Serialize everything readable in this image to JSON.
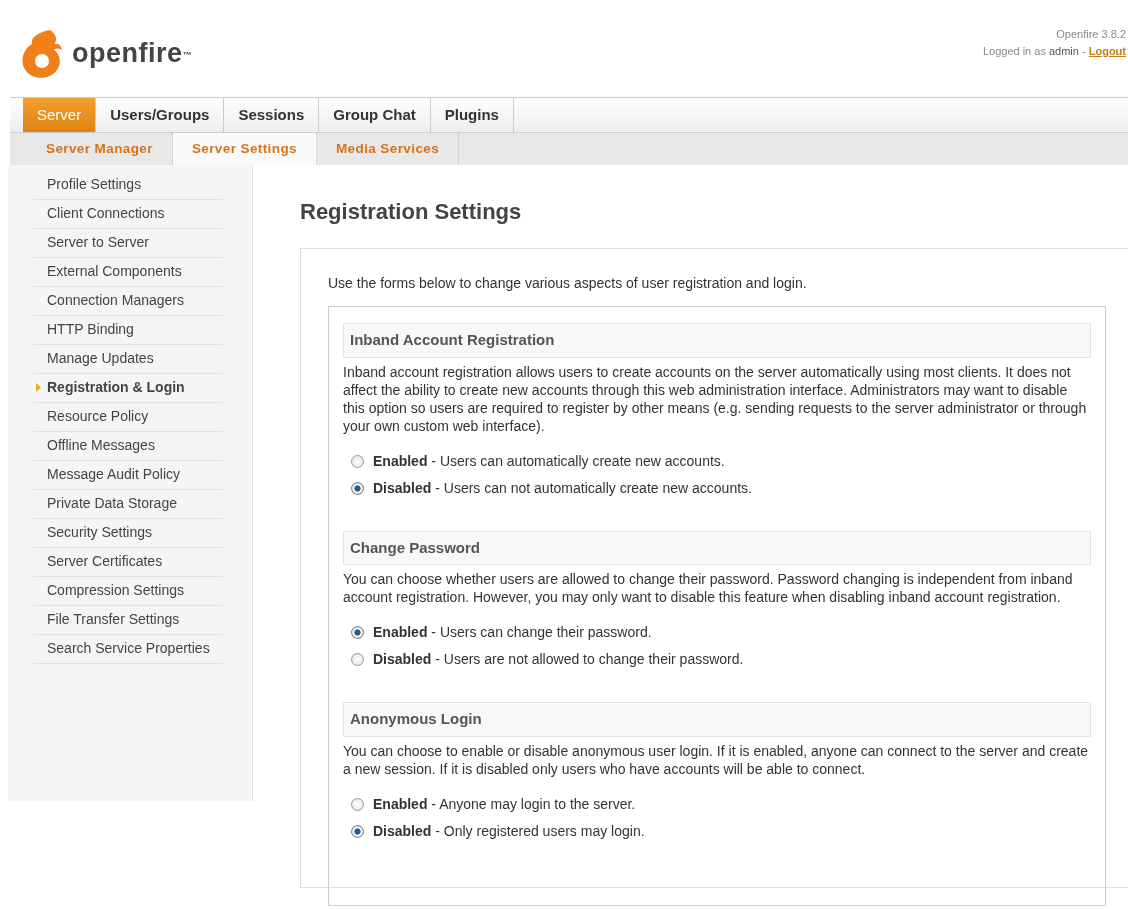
{
  "header": {
    "logo_text": "openfire$^{™}$",
    "version": "Openfire 3.8.2",
    "logged_in_prefix": "Logged in as",
    "user": "admin",
    "separator": "-",
    "logout": "Logout"
  },
  "tabs": [
    {
      "label": "Server",
      "selected": true
    },
    {
      "label": "Users/Groups",
      "selected": false
    },
    {
      "label": "Sessions",
      "selected": false
    },
    {
      "label": "Group Chat",
      "selected": false
    },
    {
      "label": "Plugins",
      "selected": false
    }
  ],
  "subtabs": [
    {
      "label": "Server Manager",
      "selected": false
    },
    {
      "label": "Server Settings",
      "selected": true
    },
    {
      "label": "Media Services",
      "selected": false
    }
  ],
  "sidebar": {
    "items": [
      {
        "label": "Profile Settings",
        "selected": false
      },
      {
        "label": "Client Connections",
        "selected": false
      },
      {
        "label": "Server to Server",
        "selected": false
      },
      {
        "label": "External Components",
        "selected": false
      },
      {
        "label": "Connection Managers",
        "selected": false
      },
      {
        "label": "HTTP Binding",
        "selected": false
      },
      {
        "label": "Manage Updates",
        "selected": false
      },
      {
        "label": "Registration & Login",
        "selected": true
      },
      {
        "label": "Resource Policy",
        "selected": false
      },
      {
        "label": "Offline Messages",
        "selected": false
      },
      {
        "label": "Message Audit Policy",
        "selected": false
      },
      {
        "label": "Private Data Storage",
        "selected": false
      },
      {
        "label": "Security Settings",
        "selected": false
      },
      {
        "label": "Server Certificates",
        "selected": false
      },
      {
        "label": "Compression Settings",
        "selected": false
      },
      {
        "label": "File Transfer Settings",
        "selected": false
      },
      {
        "label": "Search Service Properties",
        "selected": false
      }
    ]
  },
  "page": {
    "title": "Registration Settings",
    "intro": "Use the forms below to change various aspects of user registration and login.",
    "sections": [
      {
        "title": "Inband Account Registration",
        "description": "Inband account registration allows users to create accounts on the server automatically using most clients. It does not affect the ability to create new accounts through this web administration interface. Administrators may want to disable this option so users are required to register by other means (e.g. sending requests to the server administrator or through your own custom web interface).",
        "options": [
          {
            "label": "**Enabled** - Users can automatically create new accounts.",
            "selected": false
          },
          {
            "label": "**Disabled** - Users can not automatically create new accounts.",
            "selected": true
          }
        ]
      },
      {
        "title": "Change Password",
        "description": "You can choose whether users are allowed to change their password. Password changing is independent from inband account registration. However, you may only want to disable this feature when disabling inband account registration.",
        "options": [
          {
            "label": "**Enabled** - Users can change their password.",
            "selected": true
          },
          {
            "label": "**Disabled** - Users are not allowed to change their password.",
            "selected": false
          }
        ]
      },
      {
        "title": "Anonymous Login",
        "description": "You can choose to enable or disable anonymous user login. If it is enabled, anyone can connect to the server and create a new session. If it is disabled only users who have accounts will be able to connect.",
        "options": [
          {
            "label": "**Enabled** - Anyone may login to the server.",
            "selected": false
          },
          {
            "label": "**Disabled** - Only registered users may login.",
            "selected": true
          }
        ]
      }
    ]
  }
}
